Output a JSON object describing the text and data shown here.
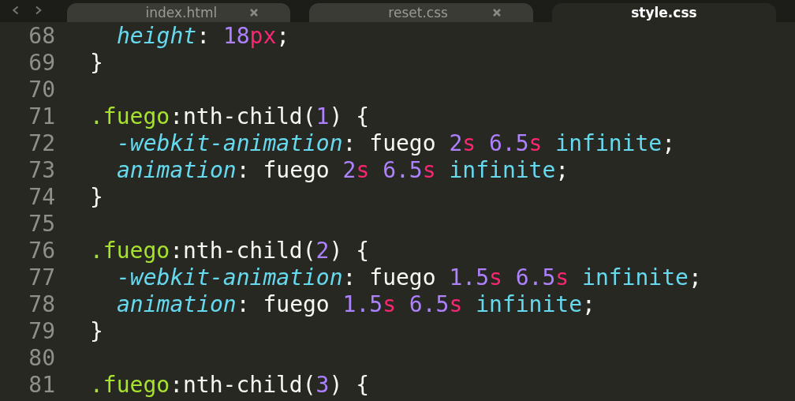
{
  "tabs": [
    {
      "label": "index.html",
      "selected": false
    },
    {
      "label": "reset.css",
      "selected": false
    },
    {
      "label": "style.css",
      "selected": true
    }
  ],
  "lines": [
    {
      "number": "68",
      "kind": "decl",
      "tokens": [
        {
          "kind": "prop",
          "text": "height"
        },
        {
          "kind": "plain",
          "text": ": "
        },
        {
          "kind": "num",
          "text": "18"
        },
        {
          "kind": "unit",
          "text": "px"
        },
        {
          "kind": "plain",
          "text": ";"
        }
      ]
    },
    {
      "number": "69",
      "kind": "rule",
      "tokens": [
        {
          "kind": "plain",
          "text": "}"
        }
      ]
    },
    {
      "number": "70",
      "kind": "blank"
    },
    {
      "number": "71",
      "kind": "rule",
      "tokens": [
        {
          "kind": "sel",
          "text": ".fuego"
        },
        {
          "kind": "plain",
          "text": ":nth-child("
        },
        {
          "kind": "num",
          "text": "1"
        },
        {
          "kind": "plain",
          "text": ") {"
        }
      ]
    },
    {
      "number": "72",
      "kind": "decl",
      "tokens": [
        {
          "kind": "prop",
          "text": "-webkit-animation"
        },
        {
          "kind": "plain",
          "text": ": fuego "
        },
        {
          "kind": "num",
          "text": "2"
        },
        {
          "kind": "unit",
          "text": "s"
        },
        {
          "kind": "num",
          "text": " 6.5"
        },
        {
          "kind": "unit",
          "text": "s"
        },
        {
          "kind": "kw",
          "text": " infinite"
        },
        {
          "kind": "plain",
          "text": ";"
        }
      ]
    },
    {
      "number": "73",
      "kind": "decl",
      "tokens": [
        {
          "kind": "prop",
          "text": "animation"
        },
        {
          "kind": "plain",
          "text": ": fuego "
        },
        {
          "kind": "num",
          "text": "2"
        },
        {
          "kind": "unit",
          "text": "s"
        },
        {
          "kind": "num",
          "text": " 6.5"
        },
        {
          "kind": "unit",
          "text": "s"
        },
        {
          "kind": "kw",
          "text": " infinite"
        },
        {
          "kind": "plain",
          "text": ";"
        }
      ]
    },
    {
      "number": "74",
      "kind": "rule",
      "tokens": [
        {
          "kind": "plain",
          "text": "}"
        }
      ]
    },
    {
      "number": "75",
      "kind": "blank"
    },
    {
      "number": "76",
      "kind": "rule",
      "tokens": [
        {
          "kind": "sel",
          "text": ".fuego"
        },
        {
          "kind": "plain",
          "text": ":nth-child("
        },
        {
          "kind": "num",
          "text": "2"
        },
        {
          "kind": "plain",
          "text": ") {"
        }
      ]
    },
    {
      "number": "77",
      "kind": "decl",
      "tokens": [
        {
          "kind": "prop",
          "text": "-webkit-animation"
        },
        {
          "kind": "plain",
          "text": ": fuego "
        },
        {
          "kind": "num",
          "text": "1.5"
        },
        {
          "kind": "unit",
          "text": "s"
        },
        {
          "kind": "num",
          "text": " 6.5"
        },
        {
          "kind": "unit",
          "text": "s"
        },
        {
          "kind": "kw",
          "text": " infinite"
        },
        {
          "kind": "plain",
          "text": ";"
        }
      ]
    },
    {
      "number": "78",
      "kind": "decl",
      "tokens": [
        {
          "kind": "prop",
          "text": "animation"
        },
        {
          "kind": "plain",
          "text": ": fuego "
        },
        {
          "kind": "num",
          "text": "1.5"
        },
        {
          "kind": "unit",
          "text": "s"
        },
        {
          "kind": "num",
          "text": " 6.5"
        },
        {
          "kind": "unit",
          "text": "s"
        },
        {
          "kind": "kw",
          "text": " infinite"
        },
        {
          "kind": "plain",
          "text": ";"
        }
      ]
    },
    {
      "number": "79",
      "kind": "rule",
      "tokens": [
        {
          "kind": "plain",
          "text": "}"
        }
      ]
    },
    {
      "number": "80",
      "kind": "blank"
    },
    {
      "number": "81",
      "kind": "rule",
      "tokens": [
        {
          "kind": "sel",
          "text": ".fuego"
        },
        {
          "kind": "plain",
          "text": ":nth-child("
        },
        {
          "kind": "num",
          "text": "3"
        },
        {
          "kind": "plain",
          "text": ") {"
        }
      ]
    }
  ]
}
